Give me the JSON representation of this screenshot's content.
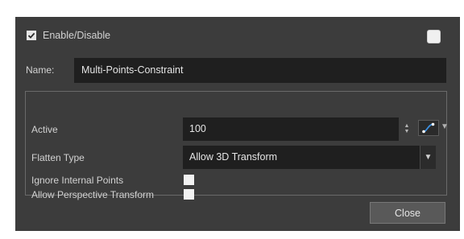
{
  "header": {
    "enable_label": "Enable/Disable",
    "enable_checked": true
  },
  "name": {
    "label": "Name:",
    "value": "Multi-Points-Constraint"
  },
  "params": {
    "active_label": "Active",
    "active_value": "100",
    "flatten_label": "Flatten Type",
    "flatten_value": "Allow 3D Transform",
    "ignore_label": "Ignore Internal Points",
    "ignore_checked": false,
    "perspective_label": "Allow Perspective Transform",
    "perspective_checked": false
  },
  "footer": {
    "close_label": "Close"
  },
  "colors": {
    "dialog_bg": "#3c3c3c",
    "field_bg": "#1f1f1f",
    "accent_blue": "#3b8fe0"
  },
  "icons": [
    "checkmark-icon",
    "spinner-arrows-icon",
    "function-curve-icon",
    "chevron-down-icon"
  ]
}
